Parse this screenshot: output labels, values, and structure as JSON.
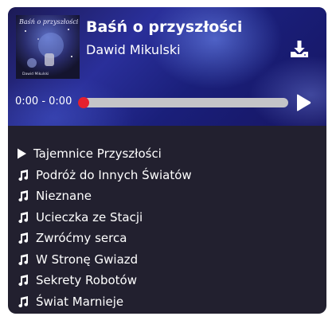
{
  "cover": {
    "title": "Baśń o przyszłości",
    "author": "Dawid Mikulski"
  },
  "track": {
    "title": "Baśń o przyszłości",
    "artist": "Dawid Mikulski",
    "time": "0:00 - 0:00",
    "progress": 0
  },
  "icons": {
    "download": "download-icon",
    "play": "play-icon",
    "now_playing": "play-icon",
    "song": "music-note-icon"
  },
  "colors": {
    "accent": "#e5202e",
    "panel": "#22202f",
    "track": "#c4c4c8",
    "text": "#ffffff"
  },
  "playlist": [
    {
      "label": "Tajemnice Przyszłości",
      "playing": true
    },
    {
      "label": "Podróż do Innych Światów",
      "playing": false
    },
    {
      "label": "Nieznane",
      "playing": false
    },
    {
      "label": "Ucieczka ze Stacji",
      "playing": false
    },
    {
      "label": "Zwróćmy serca",
      "playing": false
    },
    {
      "label": "W Stronę Gwiazd",
      "playing": false
    },
    {
      "label": "Sekrety Robotów",
      "playing": false
    },
    {
      "label": "Świat Marnieje",
      "playing": false
    }
  ]
}
